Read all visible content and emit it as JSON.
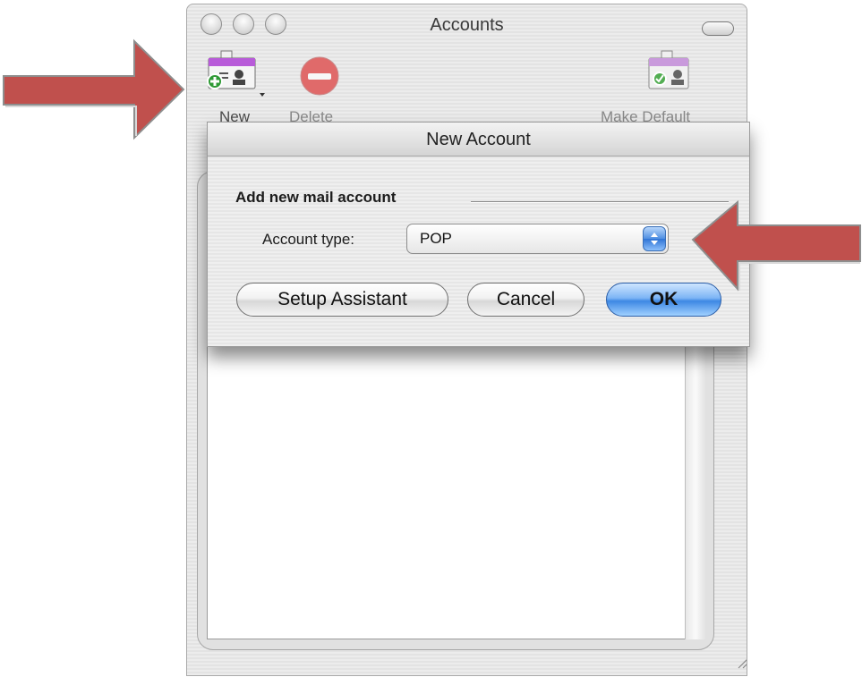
{
  "window": {
    "title": "Accounts",
    "toolbar": {
      "new_label": "New",
      "delete_label": "Delete",
      "make_default_label": "Make Default"
    }
  },
  "sheet": {
    "title": "New Account",
    "section_label": "Add new mail account",
    "account_type_label": "Account type:",
    "account_type_value": "POP",
    "buttons": {
      "setup_assistant": "Setup Assistant",
      "cancel": "Cancel",
      "ok": "OK"
    }
  },
  "icons": {
    "new": "new-account-card-icon",
    "delete": "delete-minus-icon",
    "make_default": "make-default-check-card-icon",
    "pointer_arrows": "red-arrow-icon"
  },
  "colors": {
    "arrow": "#c0504d",
    "ok_button": "#3e88e4",
    "delete_icon": "#e06a6a"
  }
}
